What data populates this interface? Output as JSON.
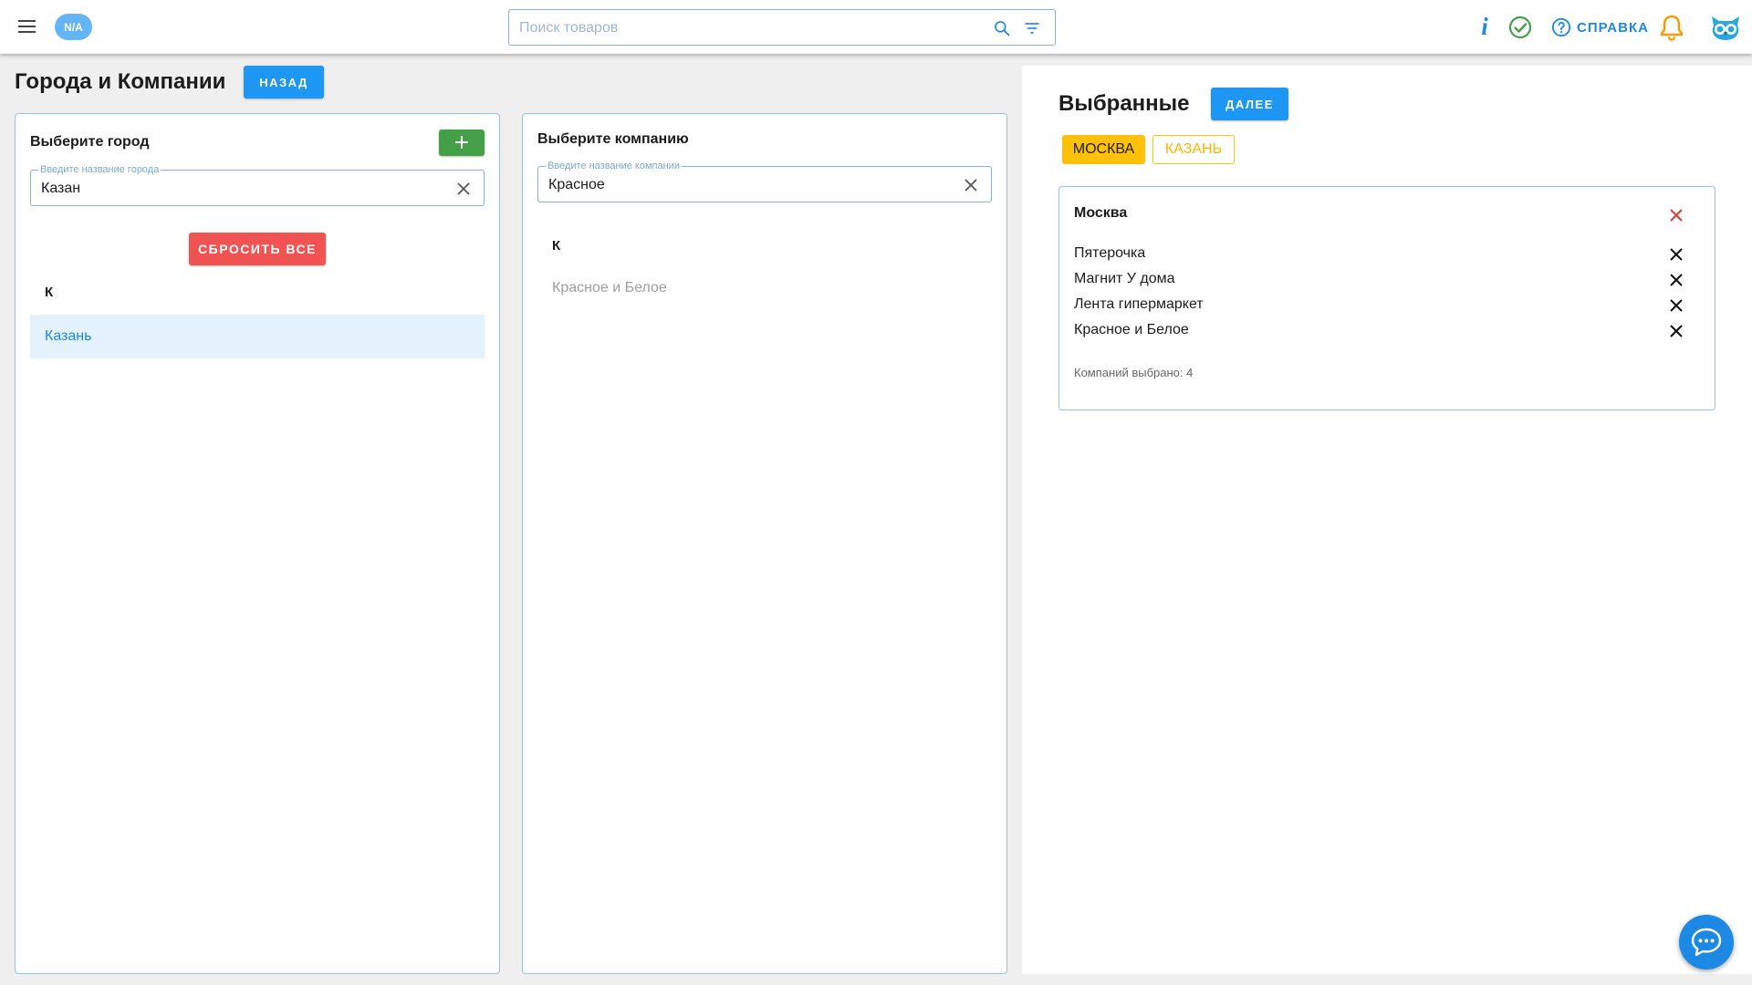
{
  "header": {
    "badge": "N/A",
    "search_placeholder": "Поиск товаров",
    "info_glyph": "i",
    "help_label": "СПРАВКА",
    "icons": [
      "menu-icon",
      "search-icon",
      "filter-icon",
      "info-icon",
      "check-circle-icon",
      "help-circle-icon",
      "bell-icon",
      "owl-logo"
    ],
    "colors": {
      "accent": "#1e88e5",
      "success": "#43a047",
      "bell": "#ff9800"
    }
  },
  "page": {
    "title": "Города и Компании",
    "back_label": "НАЗАД"
  },
  "city_panel": {
    "title": "Выберите город",
    "field_label": "Введите название города",
    "field_value": "Казан",
    "reset_label": "СБРОСИТЬ ВСЕ",
    "group_letter": "К",
    "items": [
      "Казань"
    ],
    "add_color": "#43a047",
    "reset_color": "#f15252"
  },
  "company_panel": {
    "title": "Выберите компанию",
    "field_label": "Введите название компании",
    "field_value": "Красное",
    "group_letter": "К",
    "items": [
      "Красное и Белое"
    ]
  },
  "selected": {
    "title": "Выбранные",
    "next_label": "ДАЛЕЕ",
    "chips": [
      {
        "label": "МОСКВА",
        "active": true
      },
      {
        "label": "КАЗАНЬ",
        "active": false
      }
    ],
    "chip_color": "#ffc107",
    "card": {
      "city": "Москва",
      "companies": [
        "Пятерочка",
        "Магнит У дома",
        "Лента гипермаркет",
        "Красное и Белое"
      ],
      "count_text": "Компаний выбрано: 4"
    }
  }
}
